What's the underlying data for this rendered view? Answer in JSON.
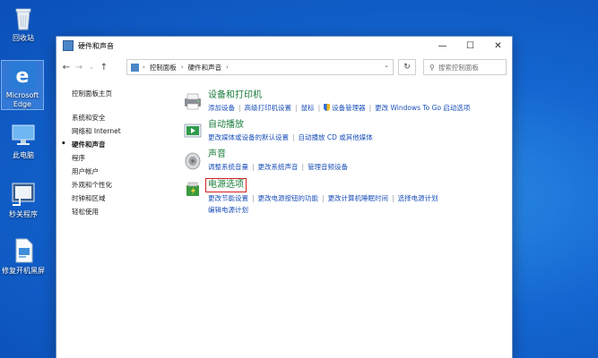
{
  "desktop": {
    "icons": [
      {
        "label": "回收站"
      },
      {
        "label": "Microsoft Edge"
      },
      {
        "label": "此电脑"
      },
      {
        "label": "秒关程序"
      },
      {
        "label": "修复开机黑屏"
      }
    ]
  },
  "window": {
    "title": "硬件和声音",
    "controls": {
      "minimize": "—",
      "maximize": "☐",
      "close": "✕"
    },
    "address": {
      "crumbs": [
        "控制面板",
        "硬件和声音"
      ]
    },
    "search": {
      "placeholder": "搜索控制面板"
    }
  },
  "leftnav": {
    "home": "控制面板主页",
    "items": [
      {
        "label": "系统和安全",
        "active": false
      },
      {
        "label": "网络和 Internet",
        "active": false
      },
      {
        "label": "硬件和声音",
        "active": true
      },
      {
        "label": "程序",
        "active": false
      },
      {
        "label": "用户帐户",
        "active": false
      },
      {
        "label": "外观和个性化",
        "active": false
      },
      {
        "label": "时钟和区域",
        "active": false
      },
      {
        "label": "轻松使用",
        "active": false
      }
    ]
  },
  "categories": [
    {
      "title": "设备和打印机",
      "icon": "printer-icon",
      "links": [
        "添加设备",
        "高级打印机设置",
        "鼠标",
        "设备管理器",
        "更改 Windows To Go 启动选项"
      ]
    },
    {
      "title": "自动播放",
      "icon": "autoplay-icon",
      "links": [
        "更改媒体或设备的默认设置",
        "自动播放 CD 或其他媒体"
      ]
    },
    {
      "title": "声音",
      "icon": "speaker-icon",
      "links": [
        "调整系统音量",
        "更改系统声音",
        "管理音频设备"
      ]
    },
    {
      "title": "电源选项",
      "icon": "power-icon",
      "links": [
        "更改节能设置",
        "更改电源按钮的功能",
        "更改计算机睡眠时间",
        "选择电源计划",
        "编辑电源计划"
      ]
    }
  ]
}
